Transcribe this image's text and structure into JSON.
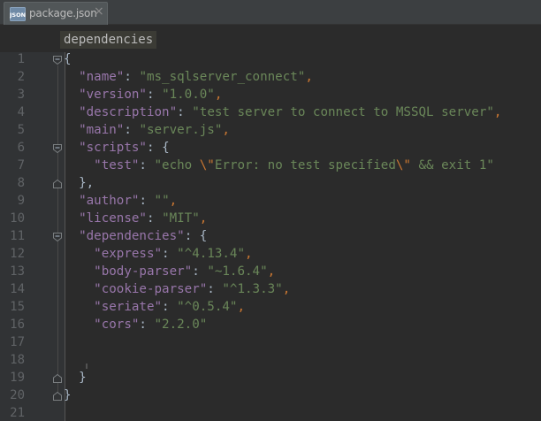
{
  "tab": {
    "icon": "json-file-icon",
    "title": "package.json",
    "close_label": "×"
  },
  "breadcrumb": "dependencies",
  "line_numbers": [
    "1",
    "2",
    "3",
    "4",
    "5",
    "6",
    "7",
    "8",
    "9",
    "10",
    "11",
    "12",
    "13",
    "14",
    "15",
    "16",
    "17",
    "18",
    "19",
    "20",
    "21"
  ],
  "code": {
    "l1_open": "{",
    "l2_key": "\"name\"",
    "l2_val": "\"ms_sqlserver_connect\"",
    "l3_key": "\"version\"",
    "l3_val": "\"1.0.0\"",
    "l4_key": "\"description\"",
    "l4_val": "\"test server to connect to MSSQL server\"",
    "l5_key": "\"main\"",
    "l5_val": "\"server.js\"",
    "l6_key": "\"scripts\"",
    "l6_open": "{",
    "l7_key": "\"test\"",
    "l7_val_a": "\"echo ",
    "l7_esc_a": "\\\"",
    "l7_val_b": "Error: no test specified",
    "l7_esc_b": "\\\"",
    "l7_val_c": " && exit 1\"",
    "l8_close": "},",
    "l9_key": "\"author\"",
    "l9_val": "\"\"",
    "l10_key": "\"license\"",
    "l10_val": "\"MIT\"",
    "l11_key": "\"dependencies\"",
    "l11_open": "{",
    "l12_key": "\"express\"",
    "l12_val": "\"^4.13.4\"",
    "l13_key": "\"body-parser\"",
    "l13_val": "\"~1.6.4\"",
    "l14_key": "\"cookie-parser\"",
    "l14_val": "\"^1.3.3\"",
    "l15_key": "\"seriate\"",
    "l15_val": "\"^0.5.4\"",
    "l16_key": "\"cors\"",
    "l16_val": "\"2.2.0\"",
    "l19_close": "}",
    "l20_close": "}"
  },
  "colors": {
    "key": "#9876aa",
    "string": "#6a8759",
    "punctuation": "#cc7832",
    "text": "#a9b7c6",
    "background": "#2b2b2b",
    "gutter": "#313335"
  }
}
